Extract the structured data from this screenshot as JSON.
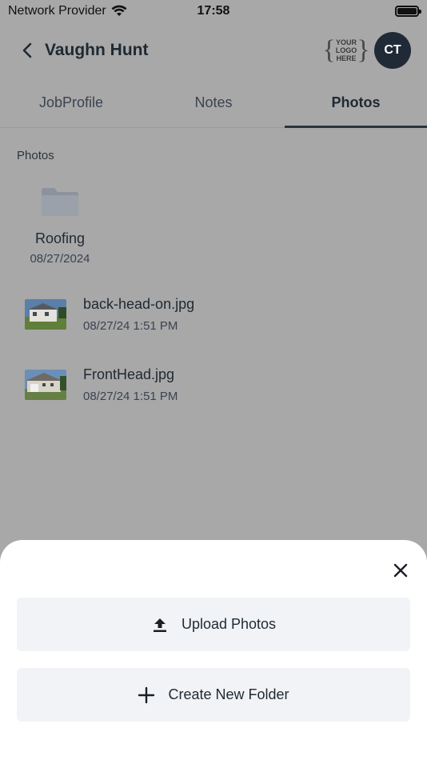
{
  "status_bar": {
    "carrier": "Network Provider",
    "time": "17:58"
  },
  "header": {
    "title": "Vaughn Hunt",
    "logo_lines": [
      "YOUR",
      "LOGO",
      "HERE"
    ],
    "avatar_initials": "CT"
  },
  "tabs": [
    {
      "label": "JobProfile",
      "active": false
    },
    {
      "label": "Notes",
      "active": false
    },
    {
      "label": "Photos",
      "active": true
    }
  ],
  "section": {
    "label": "Photos"
  },
  "folders": [
    {
      "name": "Roofing",
      "date": "08/27/2024",
      "icon": "folder-icon"
    }
  ],
  "files": [
    {
      "name": "back-head-on.jpg",
      "date": "08/27/24 1:51 PM"
    },
    {
      "name": "FrontHead.jpg",
      "date": "08/27/24 1:51 PM"
    }
  ],
  "sheet": {
    "upload_label": "Upload Photos",
    "create_folder_label": "Create New Folder"
  },
  "colors": {
    "overlay": "#a8a8a8",
    "avatar_bg": "#202a36",
    "button_bg": "#f1f3f6",
    "text_primary": "#1f2933"
  }
}
